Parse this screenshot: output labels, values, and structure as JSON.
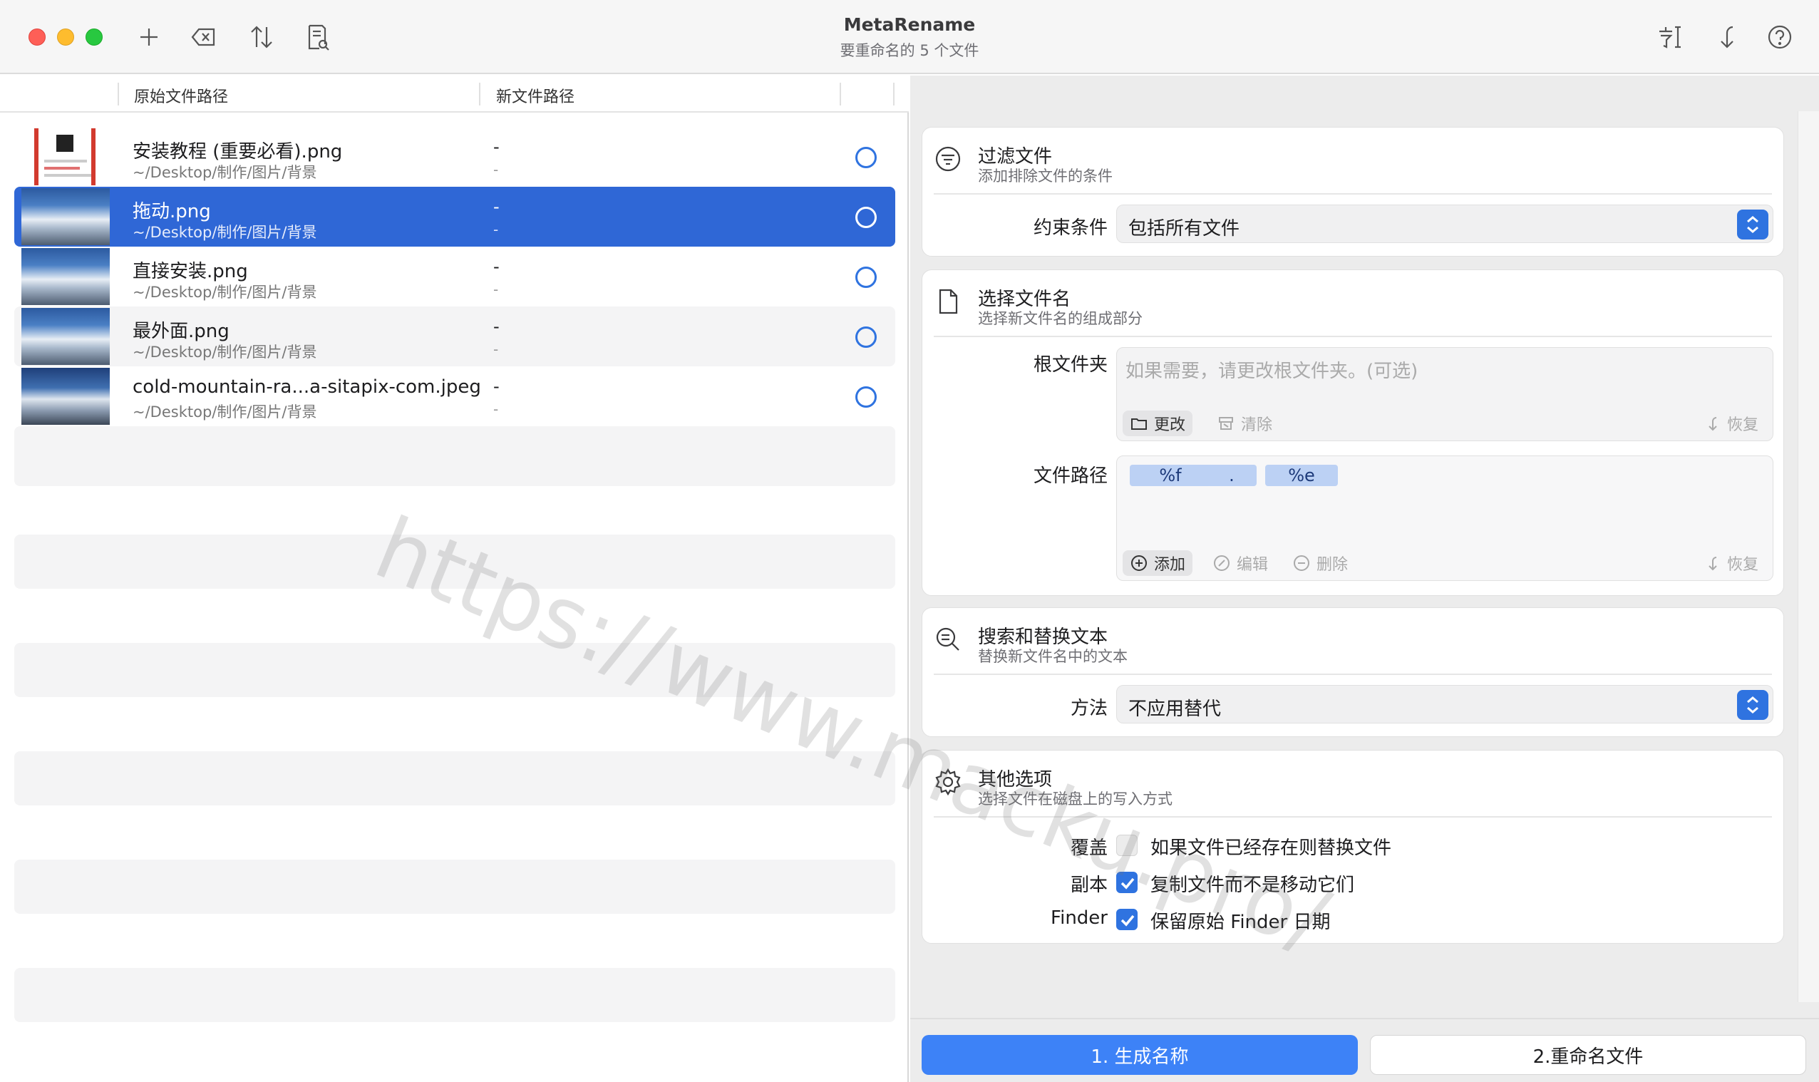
{
  "window": {
    "title": "MetaRename",
    "subtitle": "要重命名的 5 个文件"
  },
  "toolbar": {
    "left_icons": [
      "plus-icon",
      "delete-icon",
      "sort-icon",
      "document-search-icon"
    ],
    "right_icons": [
      "font-icon",
      "undo-icon",
      "help-icon"
    ]
  },
  "columns": {
    "original": "原始文件路径",
    "new": "新文件路径"
  },
  "files": [
    {
      "name": "安装教程 (重要必看).png",
      "path": "~/Desktop/制作/图片/背景",
      "new_name": "-",
      "new_path": "-",
      "thumb": "doc"
    },
    {
      "name": "拖动.png",
      "path": "~/Desktop/制作/图片/背景",
      "new_name": "-",
      "new_path": "-",
      "thumb": "mountain",
      "selected": true
    },
    {
      "name": "直接安装.png",
      "path": "~/Desktop/制作/图片/背景",
      "new_name": "-",
      "new_path": "-",
      "thumb": "mountain"
    },
    {
      "name": "最外面.png",
      "path": "~/Desktop/制作/图片/背景",
      "new_name": "-",
      "new_path": "-",
      "thumb": "mountain"
    },
    {
      "name": "cold-mountain-ra...a-sitapix-com.jpeg",
      "path": "~/Desktop/制作/图片/背景",
      "new_name": "-",
      "new_path": "-",
      "thumb": "mountain"
    }
  ],
  "filter": {
    "title": "过滤文件",
    "subtitle": "添加排除文件的条件",
    "constraint_label": "约束条件",
    "constraint_value": "包括所有文件"
  },
  "choose_name": {
    "title": "选择文件名",
    "subtitle": "选择新文件名的组成部分",
    "root_label": "根文件夹",
    "root_placeholder": "如果需要，请更改根文件夹。(可选)",
    "root_change": "更改",
    "root_clear": "清除",
    "root_restore": "恢复",
    "path_label": "文件路径",
    "tokens": [
      "%f",
      ".",
      "%e"
    ],
    "path_add": "添加",
    "path_edit": "编辑",
    "path_delete": "删除",
    "path_restore": "恢复"
  },
  "search_replace": {
    "title": "搜索和替换文本",
    "subtitle": "替换新文件名中的文本",
    "method_label": "方法",
    "method_value": "不应用替代"
  },
  "other": {
    "title": "其他选项",
    "subtitle": "选择文件在磁盘上的写入方式",
    "overwrite_label": "覆盖",
    "overwrite_text": "如果文件已经存在则替换文件",
    "overwrite_checked": false,
    "copy_label": "副本",
    "copy_text": "复制文件而不是移动它们",
    "copy_checked": true,
    "finder_label": "Finder",
    "finder_text": "保留原始 Finder 日期",
    "finder_checked": true
  },
  "actions": {
    "generate": "1. 生成名称",
    "rename": "2.重命名文件"
  },
  "watermark": "https://www.macku.pro/",
  "colors": {
    "accent": "#2f73e0",
    "selected_row": "#2f67d6",
    "primary_button": "#3d82f7"
  }
}
